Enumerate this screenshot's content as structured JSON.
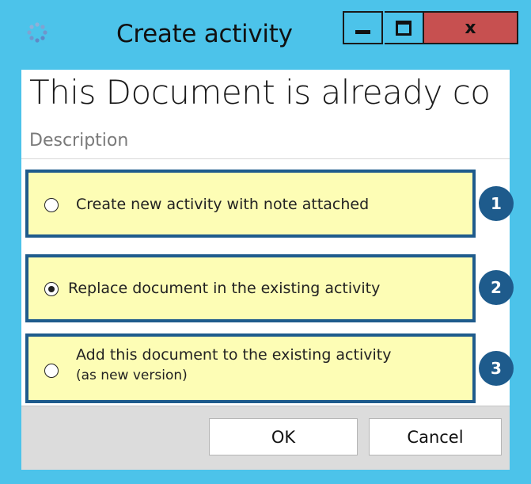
{
  "window": {
    "title": "Create activity",
    "minimize_glyph": "",
    "close_glyph": "x",
    "icon": "app-logo-icon"
  },
  "content": {
    "heading": "This Document is already co",
    "description_label": "Description"
  },
  "options": [
    {
      "label": "Create new activity with note attached",
      "selected": false,
      "badge": "1"
    },
    {
      "label": "Replace document in the existing activity",
      "selected": true,
      "badge": "2"
    },
    {
      "label_line1": "Add this document to the existing activity",
      "label_line2": "(as new version)",
      "selected": false,
      "badge": "3"
    }
  ],
  "footer": {
    "ok_label": "OK",
    "cancel_label": "Cancel"
  },
  "colors": {
    "titlebar": "#4cc3ea",
    "close": "#c75050",
    "option_bg": "#fdfdb5",
    "accent": "#1e5b8c"
  }
}
